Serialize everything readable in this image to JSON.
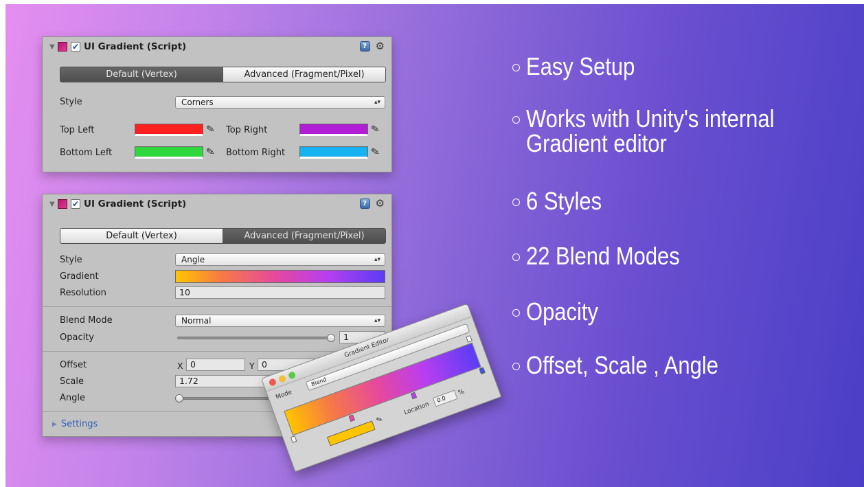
{
  "component_title": "UI Gradient (Script)",
  "icons": {
    "help": "help-book-icon",
    "settings": "gear-icon",
    "collapse": "triangle-down-icon",
    "checkmark": "checkmark-icon",
    "eyedropper": "eyedropper-icon"
  },
  "tabs": {
    "default": "Default (Vertex)",
    "advanced": "Advanced (Fragment/Pixel)"
  },
  "panel_corners": {
    "style_label": "Style",
    "style_value": "Corners",
    "top_left": {
      "label": "Top Left",
      "color": "#ff2020"
    },
    "top_right": {
      "label": "Top Right",
      "color": "#b21dd6"
    },
    "bottom_left": {
      "label": "Bottom Left",
      "color": "#2fd83c"
    },
    "bottom_right": {
      "label": "Bottom Right",
      "color": "#17b2f2"
    }
  },
  "panel_angle": {
    "style_label": "Style",
    "style_value": "Angle",
    "gradient_label": "Gradient",
    "resolution_label": "Resolution",
    "resolution_value": "10",
    "blend_mode_label": "Blend Mode",
    "blend_mode_value": "Normal",
    "opacity_label": "Opacity",
    "opacity_value": "1",
    "offset_label": "Offset",
    "offset_x_label": "X",
    "offset_x_value": "0",
    "offset_y_label": "Y",
    "offset_y_value": "0",
    "scale_label": "Scale",
    "scale_value": "1.72",
    "angle_label": "Angle",
    "settings_label": "Settings"
  },
  "gradient_editor": {
    "title": "Gradient Editor",
    "mode_label": "Mode",
    "mode_value": "Blend",
    "location_label": "Location",
    "location_value": "0.0",
    "percent": "%"
  },
  "features": [
    "Easy Setup",
    "Works with Unity's internal",
    "Gradient editor",
    "6 Styles",
    "22 Blend Modes",
    "Opacity",
    "Offset, Scale , Angle"
  ],
  "colors": {
    "gradient_stops": [
      "#ffc400",
      "#f77a45",
      "#e6489e",
      "#b93ef0",
      "#5a3df5"
    ],
    "background_start": "#e58ef0",
    "background_end": "#4a3fc6"
  }
}
